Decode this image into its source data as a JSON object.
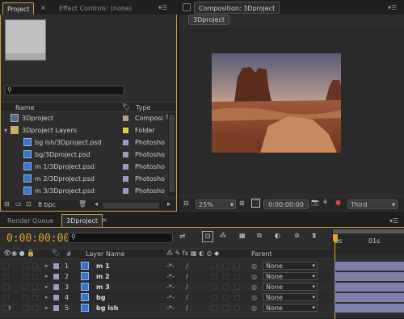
{
  "project_panel": {
    "tabs": [
      {
        "label": "Project"
      },
      {
        "label": "Effect Controls: (none)"
      }
    ],
    "search": {
      "value": "",
      "placeholder": ""
    },
    "columns": {
      "name": "Name",
      "type": "Type"
    },
    "items": [
      {
        "label": "3Dproject",
        "type": "Composi",
        "swatch": "#b8a078",
        "indent": 0,
        "icon": "composition-icon"
      },
      {
        "label": "3Dproject Layers",
        "type": "Folder",
        "swatch": "#e0d040",
        "indent": 0,
        "icon": "folder-icon"
      },
      {
        "label": "bg ish/3Dproject.psd",
        "type": "Photosho",
        "swatch": "#9a9ac8",
        "indent": 1,
        "icon": "photoshop-file-icon"
      },
      {
        "label": "bg/3Dproject.psd",
        "type": "Photosho",
        "swatch": "#9a9ac8",
        "indent": 1,
        "icon": "photoshop-file-icon"
      },
      {
        "label": "m 1/3Dproject.psd",
        "type": "Photosho",
        "swatch": "#9a9ac8",
        "indent": 1,
        "icon": "photoshop-file-icon"
      },
      {
        "label": "m 2/3Dproject.psd",
        "type": "Photosho",
        "swatch": "#9a9ac8",
        "indent": 1,
        "icon": "photoshop-file-icon"
      },
      {
        "label": "m 3/3Dproject.psd",
        "type": "Photosho",
        "swatch": "#9a9ac8",
        "indent": 1,
        "icon": "photoshop-file-icon"
      }
    ],
    "bpc": "8 bpc"
  },
  "composition_panel": {
    "tab": "Composition: 3Dproject",
    "comp_button": "3Dproject",
    "zoom": "25%",
    "timecode": "0:00:00:00",
    "view": "Third"
  },
  "timeline": {
    "tabs": [
      {
        "label": "Render Queue"
      },
      {
        "label": "3Dproject"
      }
    ],
    "timecode": "0:00:00:00",
    "search": {
      "value": "",
      "placeholder": ""
    },
    "ruler": [
      "0s",
      "01s"
    ],
    "headers": {
      "number": "#",
      "layer_name": "Layer Name",
      "parent": "Parent"
    },
    "layers": [
      {
        "num": "1",
        "name": "m 1",
        "parent": "None"
      },
      {
        "num": "2",
        "name": "m 2",
        "parent": "None"
      },
      {
        "num": "3",
        "name": "m 3",
        "parent": "None"
      },
      {
        "num": "4",
        "name": "bg",
        "parent": "None"
      },
      {
        "num": "5",
        "name": "bg ish",
        "parent": "None"
      }
    ]
  },
  "colors": {
    "accent": "#e8a21c",
    "layer_label": "#9a9ac8",
    "layer_bar": "#7f7faa"
  }
}
